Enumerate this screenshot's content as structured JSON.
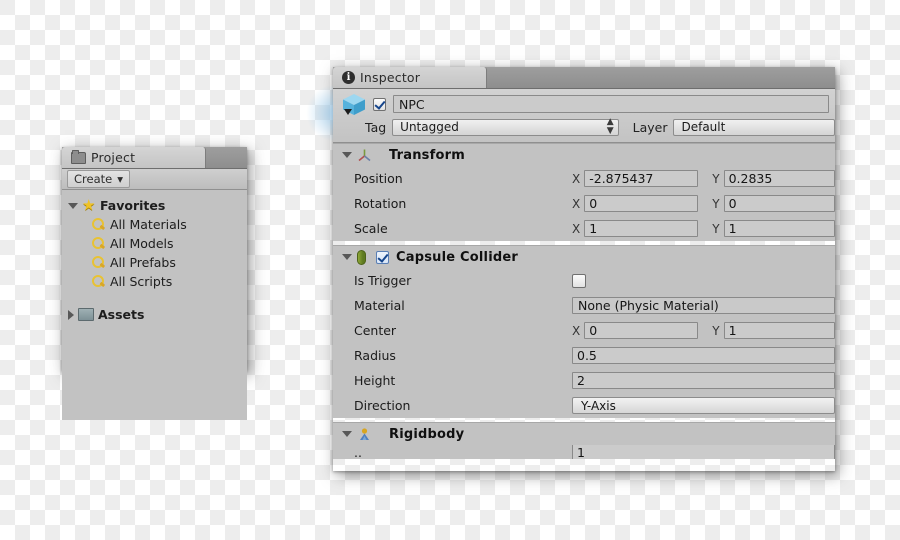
{
  "project_panel": {
    "tab": {
      "label": "Project",
      "icon": "folder-icon"
    },
    "toolbar": {
      "create_label": "Create",
      "create_arrow": "▾"
    },
    "tree": [
      {
        "label": "Favorites",
        "icon": "star-icon",
        "expander": "▼",
        "level": 0
      },
      {
        "label": "All Materials",
        "icon": "search-icon",
        "level": 1
      },
      {
        "label": "All Models",
        "icon": "search-icon",
        "level": 1
      },
      {
        "label": "All Prefabs",
        "icon": "search-icon",
        "level": 1
      },
      {
        "label": "All Scripts",
        "icon": "search-icon",
        "level": 1
      },
      {
        "label": "Assets",
        "icon": "assets-folder-icon",
        "expander": "▶",
        "level": 0
      }
    ]
  },
  "inspector": {
    "tab": {
      "label": "Inspector",
      "icon": "info-icon",
      "badge": "i"
    },
    "game_object": {
      "icon": "prefab-cube-icon",
      "enabled": true,
      "name": "NPC",
      "tag_label": "Tag",
      "tag_value": "Untagged",
      "layer_label": "Layer",
      "layer_value": "Default"
    },
    "components": [
      {
        "name": "Transform",
        "icon": "transform-axis-icon",
        "expanded": true,
        "has_checkbox": false,
        "properties": [
          {
            "label": "Position",
            "type": "vector",
            "x_label": "X",
            "x": "-2.875437",
            "y_label": "Y",
            "y": "0.2835"
          },
          {
            "label": "Rotation",
            "type": "vector",
            "x_label": "X",
            "x": "0",
            "y_label": "Y",
            "y": "0"
          },
          {
            "label": "Scale",
            "type": "vector",
            "x_label": "X",
            "x": "1",
            "y_label": "Y",
            "y": "1"
          }
        ]
      },
      {
        "name": "Capsule Collider",
        "icon": "capsule-collider-icon",
        "expanded": true,
        "has_checkbox": true,
        "enabled": true,
        "properties": [
          {
            "label": "Is Trigger",
            "type": "checkbox",
            "value": false
          },
          {
            "label": "Material",
            "type": "object",
            "value": "None (Physic Material)"
          },
          {
            "label": "Center",
            "type": "vector",
            "x_label": "X",
            "x": "0",
            "y_label": "Y",
            "y": "1"
          },
          {
            "label": "Radius",
            "type": "number",
            "value": "0.5"
          },
          {
            "label": "Height",
            "type": "number",
            "value": "2"
          },
          {
            "label": "Direction",
            "type": "popup",
            "value": "Y-Axis"
          }
        ]
      },
      {
        "name": "Rigidbody",
        "icon": "rigidbody-icon",
        "expanded": true,
        "has_checkbox": false,
        "properties": []
      }
    ]
  },
  "colors": {
    "panel_bg": "#c2c2c2",
    "tab_active": "#d0d0d0",
    "tab_strip": "#989898",
    "field_bg": "#cbcbcb",
    "text": "#1b1b1b",
    "collider_green": "#5e7a20",
    "favorite_star": "#efc226",
    "checkbox_check": "#17468c"
  }
}
